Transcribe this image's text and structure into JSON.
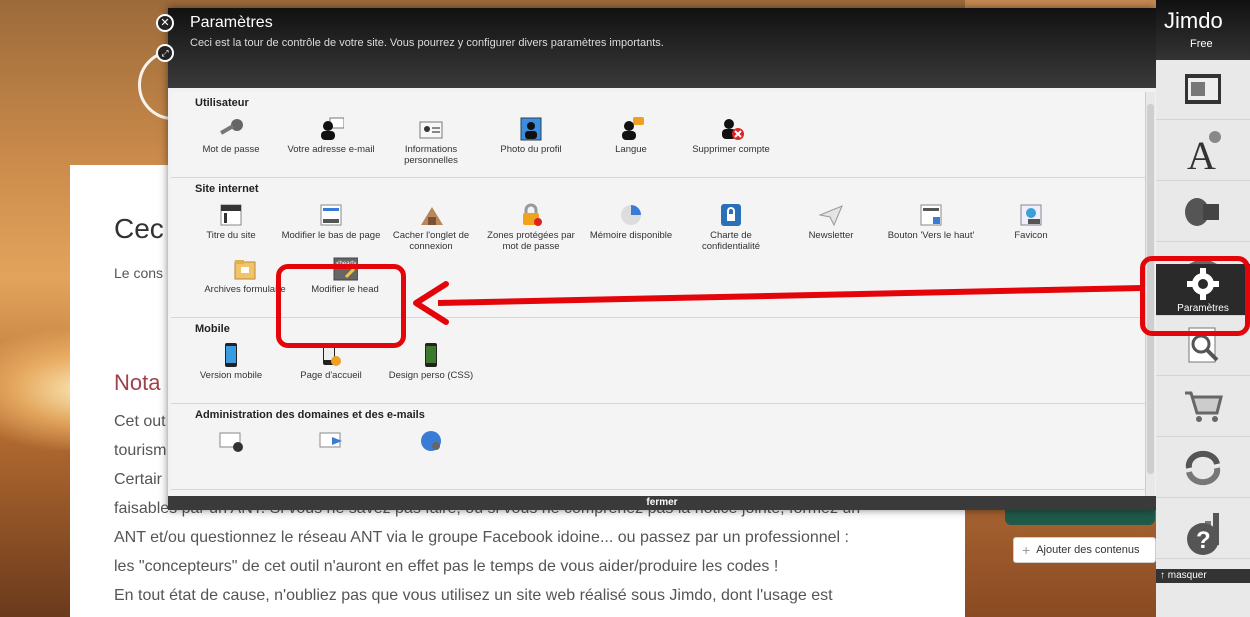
{
  "background": {
    "heading1": "Cec",
    "intro": "Le cons",
    "heading2": "Nota",
    "para_lines": [
      "Cet out",
      "tourism",
      "Certair",
      "faisables par un ANT. Si vous ne savez pas faire, ou si vous ne comprenez pas la notice jointe, formez un",
      "ANT et/ou questionnez le réseau ANT via le groupe Facebook idoine... ou passez par un professionnel :",
      "les \"concepteurs\" de cet outil n'auront en effet pas le temps de vous aider/produire les codes !",
      "En tout état de cause, n'oubliez pas que vous utilisez un site web réalisé sous Jimdo, dont l'usage est"
    ],
    "add_content": "Ajouter des contenus"
  },
  "dialog": {
    "title": "Paramètres",
    "subtitle": "Ceci est la tour de contrôle de votre site. Vous pourrez y configurer divers paramètres importants.",
    "close_icon": "close-icon",
    "resize_icon": "resize-icon",
    "footer": "fermer",
    "sections": [
      {
        "title": "Utilisateur",
        "items": [
          {
            "label": "Mot de passe",
            "icon": "key-icon"
          },
          {
            "label": "Votre adresse e-mail",
            "icon": "user-mail-icon"
          },
          {
            "label": "Informations personnelles",
            "icon": "id-card-icon"
          },
          {
            "label": "Photo du profil",
            "icon": "profile-photo-icon"
          },
          {
            "label": "Langue",
            "icon": "language-icon"
          },
          {
            "label": "Supprimer compte",
            "icon": "delete-user-icon"
          }
        ]
      },
      {
        "title": "Site internet",
        "items": [
          {
            "label": "Titre du site",
            "icon": "site-title-icon"
          },
          {
            "label": "Modifier le bas de page",
            "icon": "footer-edit-icon"
          },
          {
            "label": "Cacher l'onglet de connexion",
            "icon": "hide-login-icon"
          },
          {
            "label": "Zones protégées par mot de passe",
            "icon": "lock-icon"
          },
          {
            "label": "Mémoire disponible",
            "icon": "pie-icon"
          },
          {
            "label": "Charte de confidentialité",
            "icon": "privacy-lock-icon"
          },
          {
            "label": "Newsletter",
            "icon": "paper-plane-icon"
          },
          {
            "label": "Bouton 'Vers le haut'",
            "icon": "back-to-top-icon"
          },
          {
            "label": "Favicon",
            "icon": "favicon-icon"
          },
          {
            "label": "Archives formulaire",
            "icon": "folder-icon"
          },
          {
            "label": "Modifier le head",
            "icon": "head-code-icon"
          }
        ]
      },
      {
        "title": "Mobile",
        "items": [
          {
            "label": "Version mobile",
            "icon": "phone-icon"
          },
          {
            "label": "Page d'accueil",
            "icon": "phone-home-icon"
          },
          {
            "label": "Design perso (CSS)",
            "icon": "phone-css-icon"
          }
        ]
      },
      {
        "title": "Administration des domaines et des e-mails",
        "items": [
          {
            "label": "",
            "icon": "mail-settings-icon"
          },
          {
            "label": "",
            "icon": "mail-forward-icon"
          },
          {
            "label": "",
            "icon": "domain-globe-icon"
          }
        ]
      }
    ]
  },
  "sidebar": {
    "logo": "Jimdo",
    "plan": "Free",
    "settings_label": "Paramètres",
    "hide_label": "masquer",
    "buttons": [
      "layout-icon",
      "font-icon",
      "megaphone-icon",
      "store-box-icon",
      "gear-icon",
      "search-seo-icon",
      "cart-icon",
      "sync-icon",
      "stats-icon",
      "help-icon"
    ]
  },
  "colors": {
    "annotation": "#e4050b",
    "dialog_header": "#1a1a1a",
    "sidebar_active": "#2a2a2a"
  }
}
